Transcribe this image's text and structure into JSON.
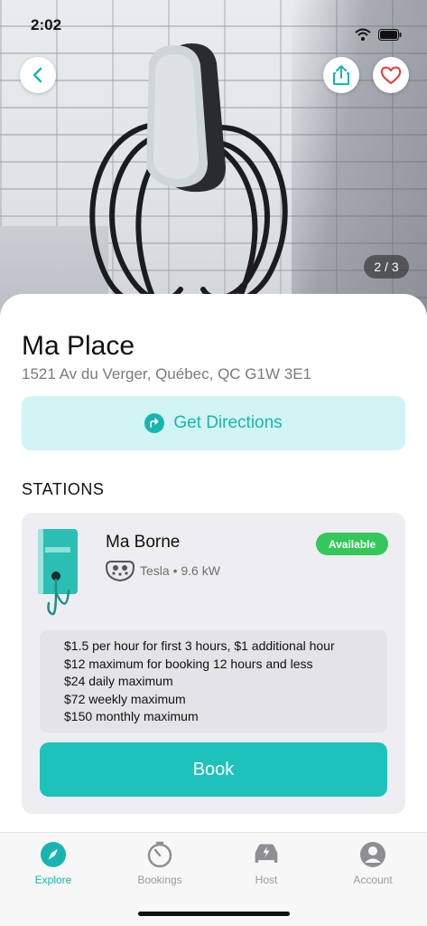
{
  "status_bar": {
    "time": "2:02"
  },
  "photo": {
    "counter": "2 / 3"
  },
  "place": {
    "title": "Ma Place",
    "address": "1521 Av du Verger, Québec, QC G1W 3E1",
    "directions_label": "Get Directions"
  },
  "stations_section": {
    "title": "STATIONS",
    "items": [
      {
        "name": "Ma Borne",
        "status": "Available",
        "connector": "Tesla • 9.6 kW",
        "pricing": [
          "$1.5 per hour for first 3 hours, $1 additional hour",
          "$12 maximum for booking 12 hours and less",
          "$24 daily maximum",
          "$72 weekly maximum",
          "$150 monthly maximum"
        ],
        "book_label": "Book"
      }
    ]
  },
  "tabs": [
    {
      "label": "Explore",
      "icon": "compass-icon",
      "active": true
    },
    {
      "label": "Bookings",
      "icon": "timer-icon",
      "active": false
    },
    {
      "label": "Host",
      "icon": "ev-car-icon",
      "active": false
    },
    {
      "label": "Account",
      "icon": "account-icon",
      "active": false
    }
  ],
  "colors": {
    "accent": "#18b5b0",
    "accent_light": "#d3f4f4",
    "available": "#34c759",
    "favorite": "#e5383b"
  }
}
